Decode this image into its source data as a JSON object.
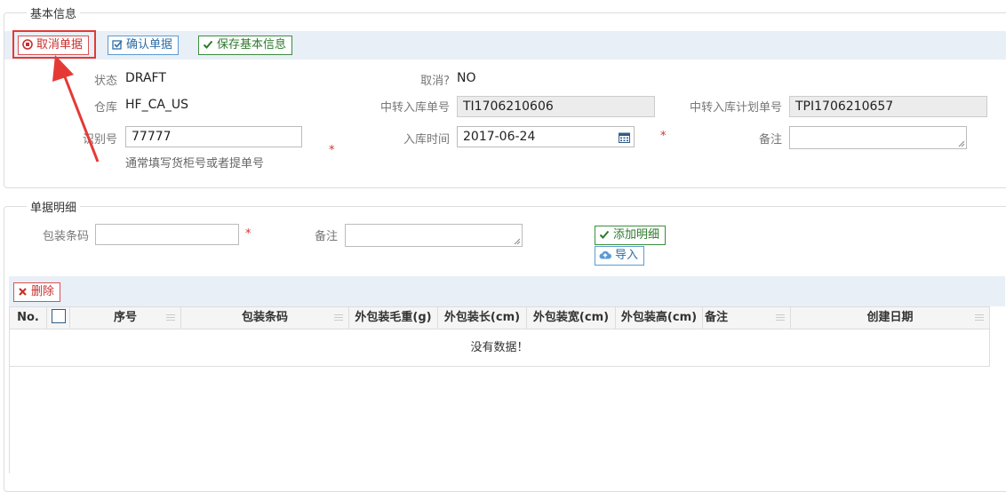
{
  "basic_info": {
    "legend": "基本信息",
    "toolbar": {
      "cancel_label": "取消单据",
      "confirm_label": "确认单据",
      "save_label": "保存基本信息"
    },
    "fields": {
      "status_label": "状态",
      "status_value": "DRAFT",
      "cancelled_label": "取消?",
      "cancelled_value": "NO",
      "warehouse_label": "仓库",
      "warehouse_value": "HF_CA_US",
      "transfer_no_label": "中转入库单号",
      "transfer_no_value": "TI1706210606",
      "transfer_plan_label": "中转入库计划单号",
      "transfer_plan_value": "TPI1706210657",
      "id_label": "识别号",
      "id_value": "77777",
      "id_help": "通常填写货柜号或者提单号",
      "inbound_time_label": "入库时间",
      "inbound_time_value": "2017-06-24",
      "remark_label": "备注",
      "required_mark": "*"
    }
  },
  "detail": {
    "legend": "单据明细",
    "barcode_label": "包装条码",
    "remark_label": "备注",
    "required_mark": "*",
    "add_label": "添加明细",
    "import_label": "导入",
    "delete_label": "删除",
    "columns": [
      "No.",
      "序号",
      "包装条码",
      "外包装毛重(g)",
      "外包装长(cm)",
      "外包装宽(cm)",
      "外包装高(cm)",
      "备注",
      "创建日期"
    ],
    "empty_text": "没有数据！"
  },
  "colors": {
    "annotation": "#e53935",
    "toolbar_bg": "#e9eff6"
  }
}
